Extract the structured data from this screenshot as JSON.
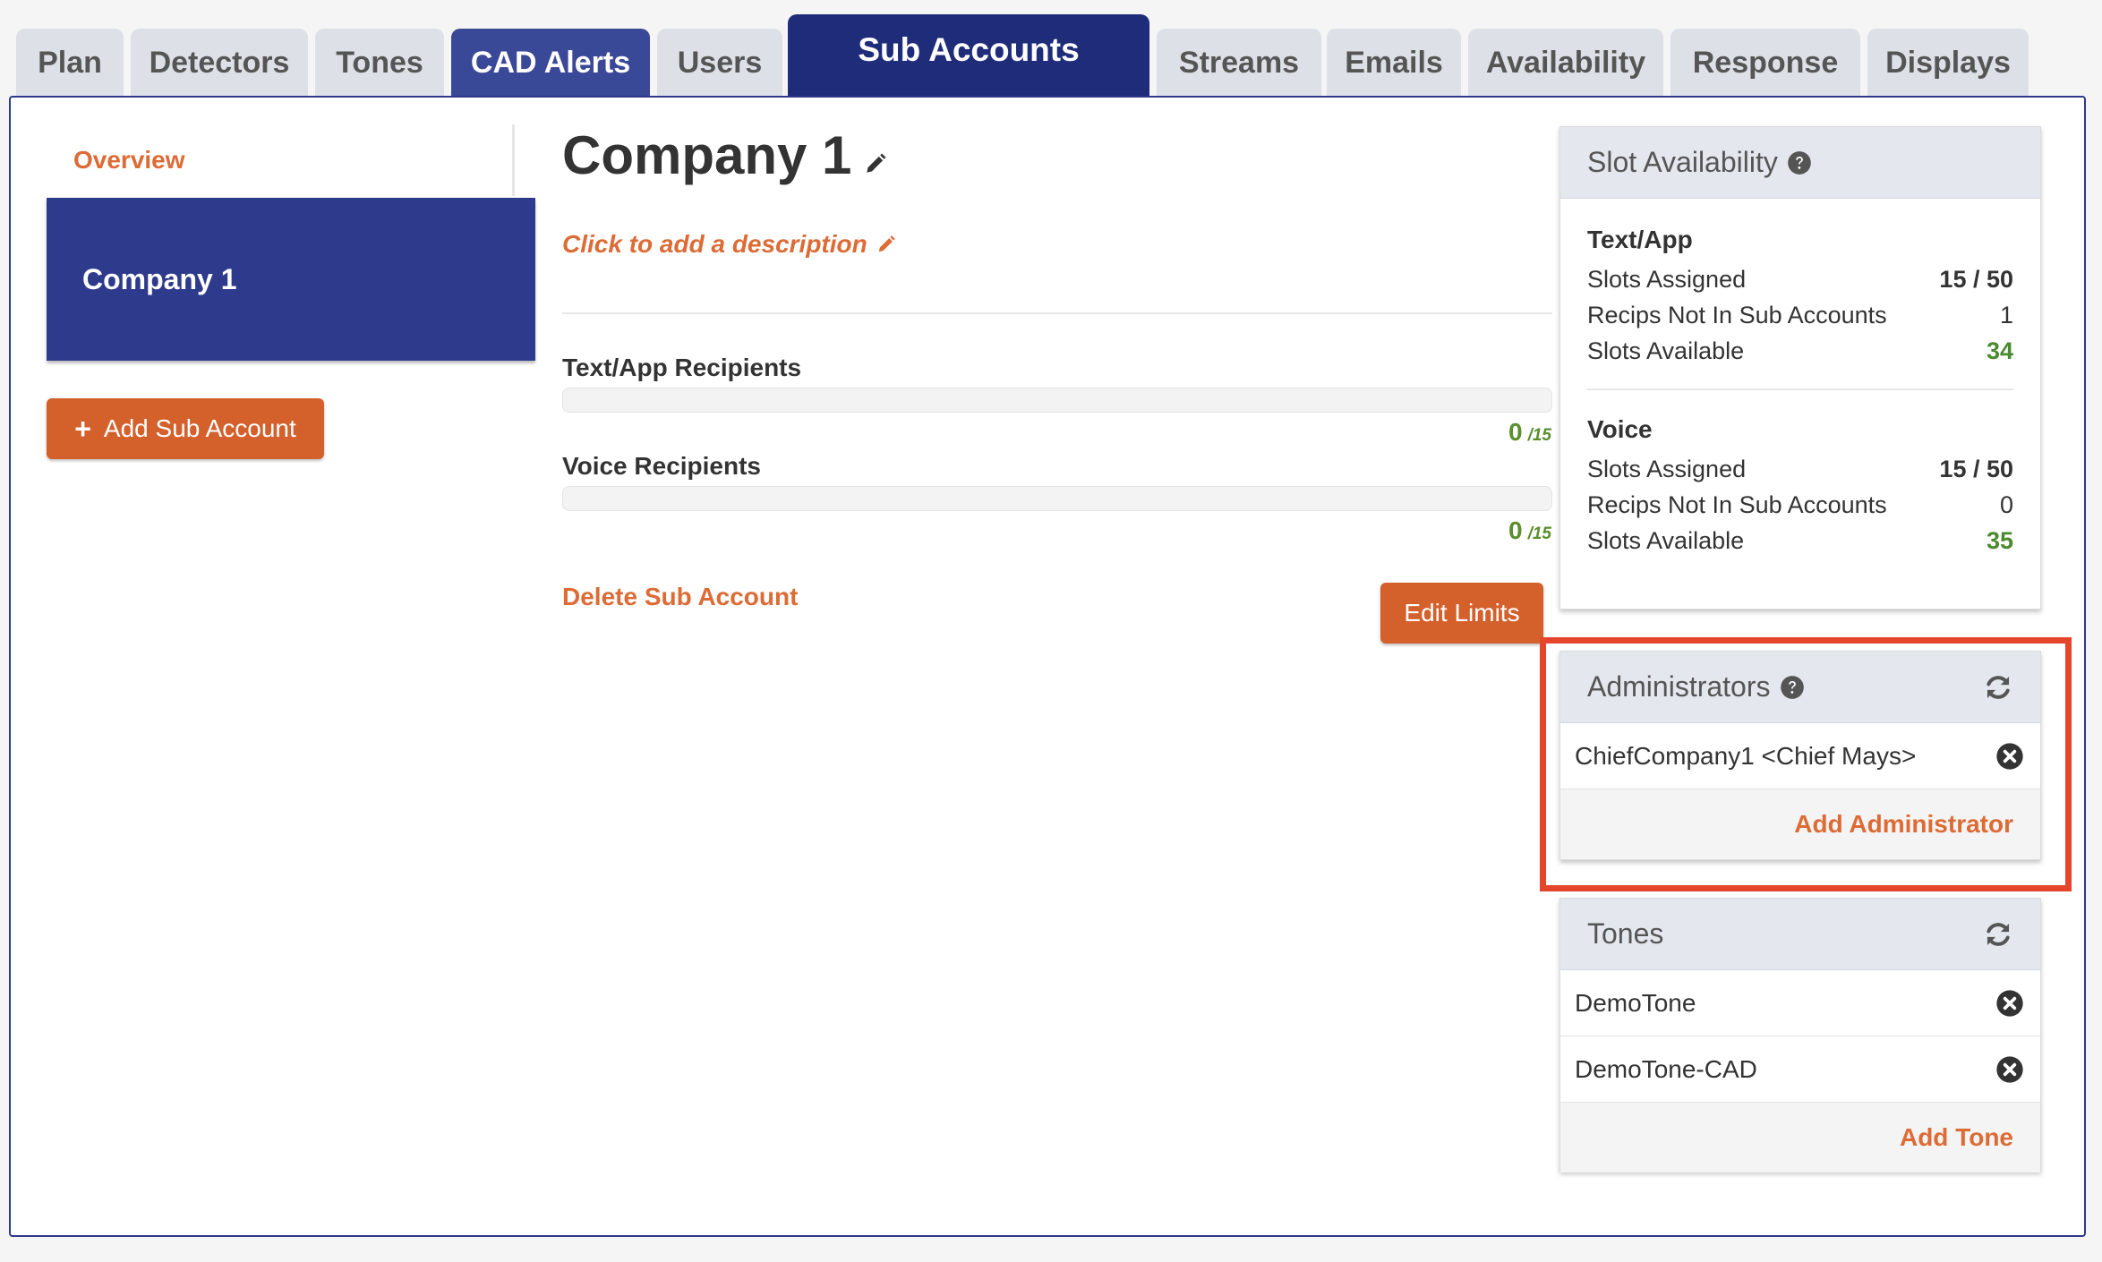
{
  "tabs": [
    {
      "label": "Plan"
    },
    {
      "label": "Detectors"
    },
    {
      "label": "Tones"
    },
    {
      "label": "CAD Alerts"
    },
    {
      "label": "Users"
    },
    {
      "label": "Sub Accounts"
    },
    {
      "label": "Streams"
    },
    {
      "label": "Emails"
    },
    {
      "label": "Availability"
    },
    {
      "label": "Response"
    },
    {
      "label": "Displays"
    }
  ],
  "sidebar": {
    "overview_label": "Overview",
    "selected_account": "Company 1",
    "add_button_label": "Add Sub Account"
  },
  "main": {
    "title": "Company 1",
    "description_prompt": "Click to add a description",
    "text_recipients": {
      "label": "Text/App Recipients",
      "count": "0",
      "limit": "/15",
      "fraction": 0
    },
    "voice_recipients": {
      "label": "Voice Recipients",
      "count": "0",
      "limit": "/15",
      "fraction": 0
    },
    "delete_label": "Delete Sub Account",
    "edit_limits_label": "Edit Limits"
  },
  "slot_availability": {
    "title": "Slot Availability",
    "text_app": {
      "title": "Text/App",
      "assigned_label": "Slots Assigned",
      "assigned_value": "15 / 50",
      "not_in_label": "Recips Not In Sub Accounts",
      "not_in_value": "1",
      "available_label": "Slots Available",
      "available_value": "34"
    },
    "voice": {
      "title": "Voice",
      "assigned_label": "Slots Assigned",
      "assigned_value": "15 / 50",
      "not_in_label": "Recips Not In Sub Accounts",
      "not_in_value": "0",
      "available_label": "Slots Available",
      "available_value": "35"
    }
  },
  "administrators": {
    "title": "Administrators",
    "items": [
      {
        "name": "ChiefCompany1 <Chief Mays>"
      }
    ],
    "add_label": "Add Administrator"
  },
  "tones": {
    "title": "Tones",
    "items": [
      {
        "name": "DemoTone"
      },
      {
        "name": "DemoTone-CAD"
      }
    ],
    "add_label": "Add Tone"
  },
  "icons": {
    "help": "question-circle-icon",
    "refresh": "refresh-icon",
    "remove": "times-circle-icon",
    "edit": "pencil-icon",
    "add": "plus-icon"
  },
  "colors": {
    "brand_navy": "#1e2c7a",
    "accent_orange": "#d4602c",
    "success_green": "#4a8a2e",
    "highlight_red": "#e4452b"
  }
}
